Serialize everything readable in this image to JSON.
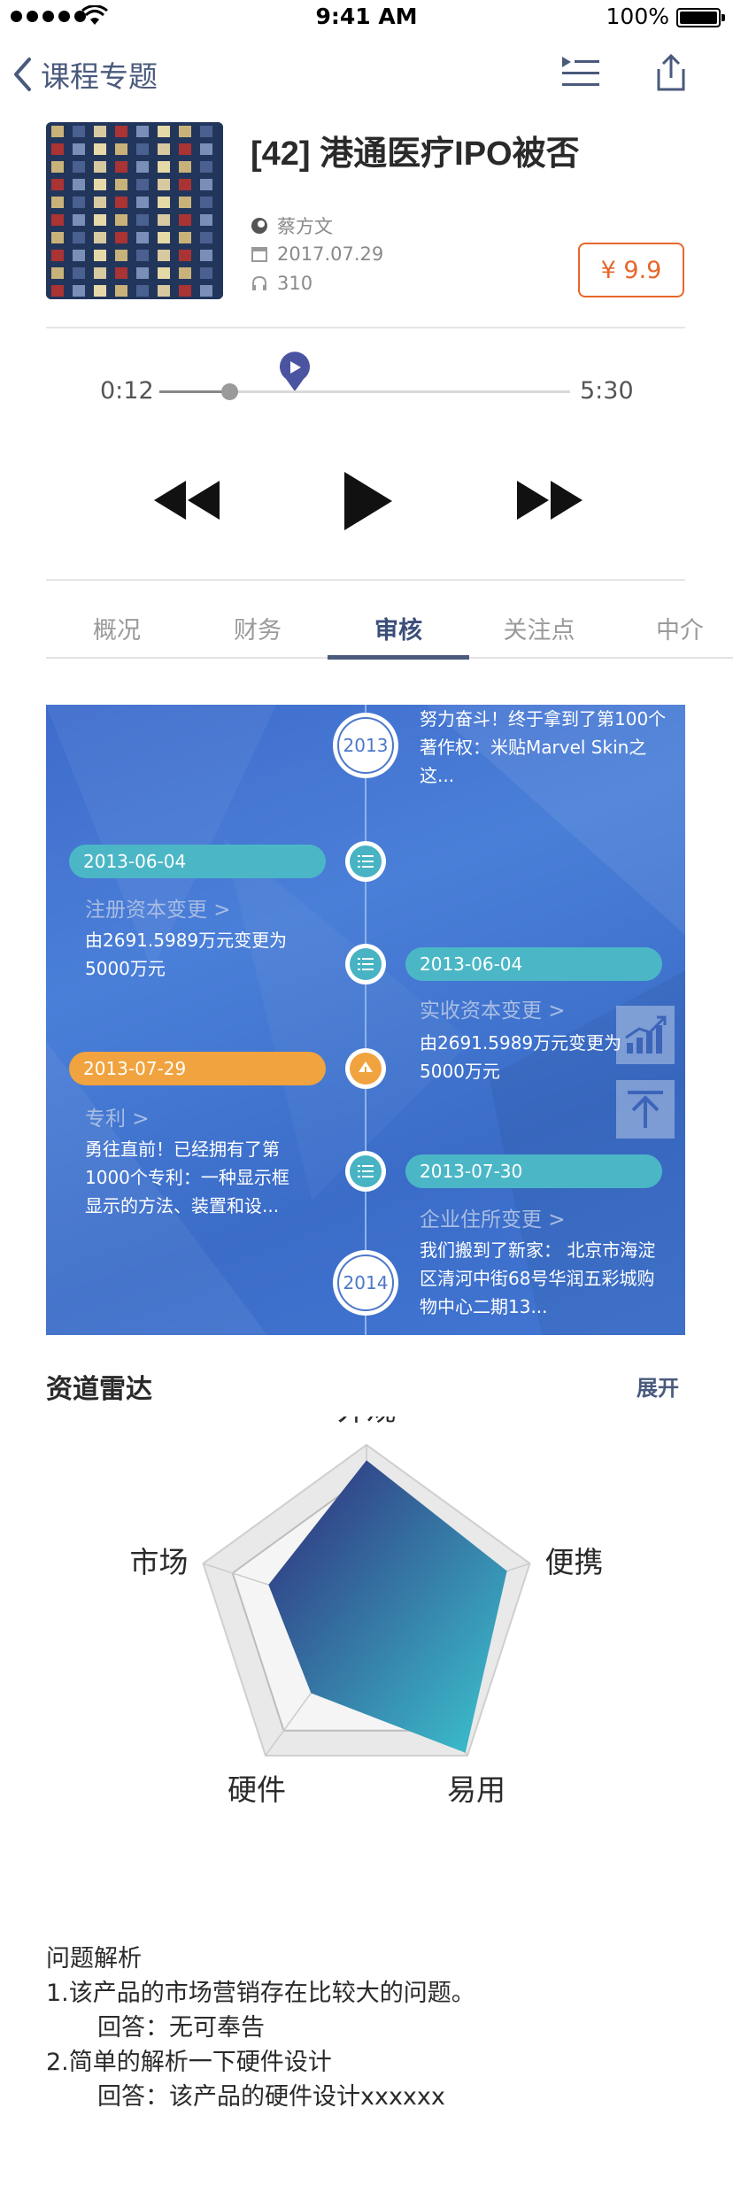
{
  "status_bar": {
    "time": "9:41 AM",
    "battery": "100%"
  },
  "nav": {
    "back_label": "课程专题"
  },
  "course": {
    "title": "[42] 港通医疗IPO被否",
    "author": "蔡方文",
    "date": "2017.07.29",
    "listens": "310",
    "price": "¥ 9.9"
  },
  "player": {
    "elapsed": "0:12",
    "duration": "5:30",
    "progress": 0.04
  },
  "tabs": [
    {
      "label": "概况"
    },
    {
      "label": "财务"
    },
    {
      "label": "审核"
    },
    {
      "label": "关注点"
    },
    {
      "label": "中介"
    }
  ],
  "active_tab": "审核",
  "timeline": {
    "top_text": "努力奋斗！终于拿到了第100个著作权：米贴Marvel Skin之这...",
    "year_start": "2013",
    "year_end": "2014",
    "events": [
      {
        "date": "2013-06-04",
        "title": "注册资本变更 >",
        "desc": "由2691.5989万元变更为5000万元"
      },
      {
        "date": "2013-06-04",
        "title": "实收资本变更 >",
        "desc": "由2691.5989万元变更为5000万元"
      },
      {
        "date": "2013-07-29",
        "title": "专利 >",
        "desc": "勇往直前！已经拥有了第1000个专利：一种显示框显示的方法、装置和设..."
      },
      {
        "date": "2013-07-30",
        "title": "企业住所变更 >",
        "desc": "我们搬到了新家： 北京市海淀区清河中街68号华润五彩城购物中心二期13..."
      }
    ]
  },
  "radar": {
    "section_title": "资道雷达",
    "expand_label": "展开",
    "axes": [
      "外观",
      "便携",
      "易用",
      "硬件",
      "市场"
    ],
    "values": [
      0.91,
      0.86,
      0.98,
      0.55,
      0.6
    ],
    "gradient": [
      "#2f2a7a",
      "#3cc6d0"
    ]
  },
  "qa": {
    "heading": "问题解析",
    "q1": "1.该产品的市场营销存在比较大的问题。",
    "a1": "回答：无可奉告",
    "q2": "2.简单的解析一下硬件设计",
    "a2": "回答：该产品的硬件设计xxxxxx"
  }
}
